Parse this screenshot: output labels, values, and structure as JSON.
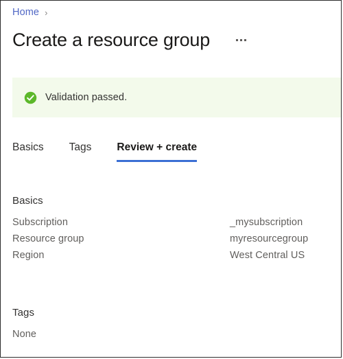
{
  "window": {
    "border_color": "#2b2b2b",
    "background": "#ffffff"
  },
  "breadcrumb": {
    "items": [
      {
        "label": "Home",
        "link_color": "#5067c5"
      }
    ],
    "separator": "›"
  },
  "header": {
    "title": "Create a resource group",
    "more_button_label": "…"
  },
  "banner": {
    "icon": "check-circle-icon",
    "message": "Validation passed.",
    "background": "#f3faeb",
    "icon_color": "#5cb82a"
  },
  "tabs": {
    "active_index": 2,
    "accent_color": "#3b6fd4",
    "items": [
      {
        "label": "Basics"
      },
      {
        "label": "Tags"
      },
      {
        "label": "Review + create"
      }
    ]
  },
  "sections": [
    {
      "heading": "Basics",
      "rows": [
        {
          "label": "Subscription",
          "value": "_mysubscription"
        },
        {
          "label": "Resource group",
          "value": "myresourcegroup"
        },
        {
          "label": "Region",
          "value": "West Central US"
        }
      ]
    },
    {
      "heading": "Tags",
      "empty_text": "None",
      "rows": []
    }
  ]
}
